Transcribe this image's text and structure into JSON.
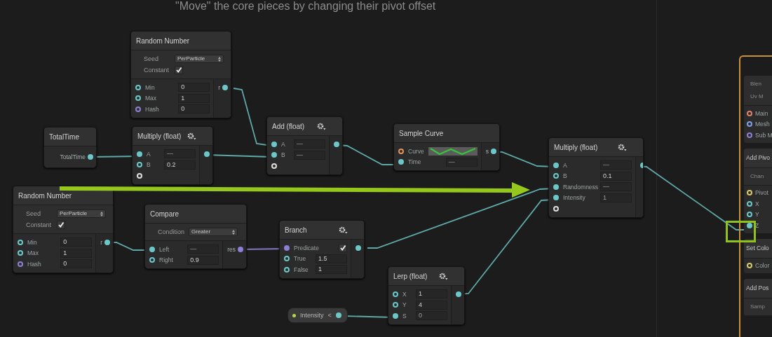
{
  "caption": "\"Move\" the core pieces by changing their pivot offset",
  "nodes": [
    {
      "kind": "operator",
      "title": "Random Number",
      "gear": false,
      "settings": [
        {
          "kind": "dropdown",
          "label": "Seed",
          "value": "PerParticle"
        },
        {
          "kind": "checkbox",
          "label": "Constant",
          "checked": true
        }
      ],
      "inputs": [
        {
          "kind": "field",
          "label": "Min",
          "value": "0",
          "color": "#6cc8c8",
          "connected": false
        },
        {
          "kind": "field",
          "label": "Max",
          "value": "1",
          "color": "#6cc8c8",
          "connected": false
        },
        {
          "kind": "field",
          "label": "Hash",
          "value": "0",
          "color": "#8d7fd6",
          "connected": false
        }
      ],
      "outputs": [
        {
          "label": "r",
          "color": "#6cc8c8",
          "connected": true
        }
      ]
    },
    {
      "kind": "operator",
      "title": "TotalTime",
      "gear": false,
      "outputs": [
        {
          "label": "TotalTime",
          "color": "#6cc8c8",
          "connected": true
        }
      ]
    },
    {
      "kind": "operator",
      "title": "Multiply (float)",
      "gear": true,
      "inputs": [
        {
          "kind": "field",
          "label": "A",
          "value": "—",
          "color": "#6cc8c8",
          "connected": true
        },
        {
          "kind": "field",
          "label": "B",
          "value": "0.2",
          "color": "#6cc8c8",
          "connected": false
        },
        {
          "kind": "none",
          "color": "#dddddd",
          "connected": false
        }
      ],
      "outputs": [
        {
          "color": "#6cc8c8",
          "connected": true
        }
      ]
    },
    {
      "kind": "operator",
      "title": "Add (float)",
      "gear": true,
      "inputs": [
        {
          "kind": "field",
          "label": "A",
          "value": "—",
          "color": "#6cc8c8",
          "connected": true
        },
        {
          "kind": "field",
          "label": "B",
          "value": "—",
          "color": "#6cc8c8",
          "connected": true
        },
        {
          "kind": "none",
          "color": "#dddddd",
          "connected": false
        }
      ],
      "outputs": [
        {
          "color": "#6cc8c8",
          "connected": true
        }
      ]
    },
    {
      "kind": "operator",
      "title": "Sample Curve",
      "gear": false,
      "inputs": [
        {
          "kind": "curve",
          "label": "Curve",
          "color": "#e0915a",
          "connected": false
        },
        {
          "kind": "field",
          "label": "Time",
          "value": "—",
          "color": "#6cc8c8",
          "connected": true
        }
      ],
      "outputs": [
        {
          "label": "s",
          "color": "#6cc8c8",
          "connected": true
        }
      ]
    },
    {
      "kind": "operator",
      "title": "Multiply (float)",
      "gear": true,
      "inputs": [
        {
          "kind": "field",
          "label": "A",
          "value": "—",
          "color": "#6cc8c8",
          "connected": true
        },
        {
          "kind": "field",
          "label": "B",
          "value": "0.1",
          "color": "#6cc8c8",
          "connected": false
        },
        {
          "kind": "field",
          "label": "Randomness",
          "value": "—",
          "color": "#6cc8c8",
          "connected": true
        },
        {
          "kind": "field",
          "label": "Intensity",
          "value": "1",
          "color": "#6cc8c8",
          "connected": true
        },
        {
          "kind": "none",
          "color": "#dddddd",
          "connected": false
        }
      ],
      "outputs": [
        {
          "color": "#6cc8c8",
          "connected": true
        }
      ]
    },
    {
      "kind": "operator",
      "title": "Random Number",
      "gear": false,
      "settings": [
        {
          "kind": "dropdown",
          "label": "Seed",
          "value": "PerParticle"
        },
        {
          "kind": "checkbox",
          "label": "Constant",
          "checked": true
        }
      ],
      "inputs": [
        {
          "kind": "field",
          "label": "Min",
          "value": "0",
          "color": "#6cc8c8",
          "connected": false
        },
        {
          "kind": "field",
          "label": "Max",
          "value": "1",
          "color": "#6cc8c8",
          "connected": false
        },
        {
          "kind": "field",
          "label": "Hash",
          "value": "0",
          "color": "#8d7fd6",
          "connected": false
        }
      ],
      "outputs": [
        {
          "label": "r",
          "color": "#6cc8c8",
          "connected": true
        }
      ]
    },
    {
      "kind": "operator",
      "title": "Compare",
      "gear": false,
      "settings": [
        {
          "kind": "dropdown",
          "label": "Condition",
          "value": "Greater"
        }
      ],
      "inputs": [
        {
          "kind": "field",
          "label": "Left",
          "value": "—",
          "color": "#6cc8c8",
          "connected": true
        },
        {
          "kind": "field",
          "label": "Right",
          "value": "0.9",
          "color": "#6cc8c8",
          "connected": false
        }
      ],
      "outputs": [
        {
          "label": "res",
          "color": "#8d7fd6",
          "connected": true
        }
      ]
    },
    {
      "kind": "operator",
      "title": "Branch",
      "gear": true,
      "inputs": [
        {
          "kind": "checkbox",
          "label": "Predicate",
          "checked": true,
          "color": "#8d7fd6",
          "connected": true
        },
        {
          "kind": "field",
          "label": "True",
          "value": "1.5",
          "color": "#6cc8c8",
          "connected": false
        },
        {
          "kind": "field",
          "label": "False",
          "value": "1",
          "color": "#6cc8c8",
          "connected": false
        }
      ],
      "outputs": [
        {
          "color": "#6cc8c8",
          "connected": true
        }
      ]
    },
    {
      "kind": "property",
      "label": "Intensity",
      "color": "#b4d64a",
      "toggle": "<",
      "output": {
        "color": "#6cc8c8",
        "connected": true
      }
    },
    {
      "kind": "operator",
      "title": "Lerp (float)",
      "gear": true,
      "inputs": [
        {
          "kind": "field",
          "label": "X",
          "value": "1",
          "color": "#6cc8c8",
          "connected": false
        },
        {
          "kind": "field",
          "label": "Y",
          "value": "4",
          "color": "#6cc8c8",
          "connected": false
        },
        {
          "kind": "field",
          "label": "S",
          "value": "0",
          "color": "#6cc8c8",
          "connected": true
        }
      ],
      "outputs": [
        {
          "color": "#6cc8c8",
          "connected": true
        }
      ]
    }
  ],
  "context": {
    "blocks": [
      {
        "settings": [
          "Blen",
          "Uv M"
        ],
        "ports": [
          {
            "label": "Main",
            "color": "#e0806a",
            "connected": false
          },
          {
            "label": "Mesh",
            "color": "#7f9fe6",
            "connected": false
          },
          {
            "label": "Sub M",
            "color": "#8d7fd6",
            "connected": false
          }
        ]
      },
      {
        "title": "Add Pivo",
        "settings": [
          "Chan"
        ],
        "ports": [
          {
            "label": "Pivot",
            "color": "#d8c96a",
            "connected": false
          },
          {
            "label": "X",
            "color": "#6cc8c8",
            "connected": false
          },
          {
            "label": "Y",
            "color": "#6cc8c8",
            "connected": false
          },
          {
            "label": "Z",
            "color": "#6cc8c8",
            "connected": true
          }
        ]
      },
      {
        "title": "Set Colo",
        "ports": [
          {
            "label": "Color",
            "color": "#d8c96a",
            "connected": false
          }
        ]
      },
      {
        "title": "Add Pos",
        "settings": [
          "Samp"
        ]
      }
    ]
  }
}
